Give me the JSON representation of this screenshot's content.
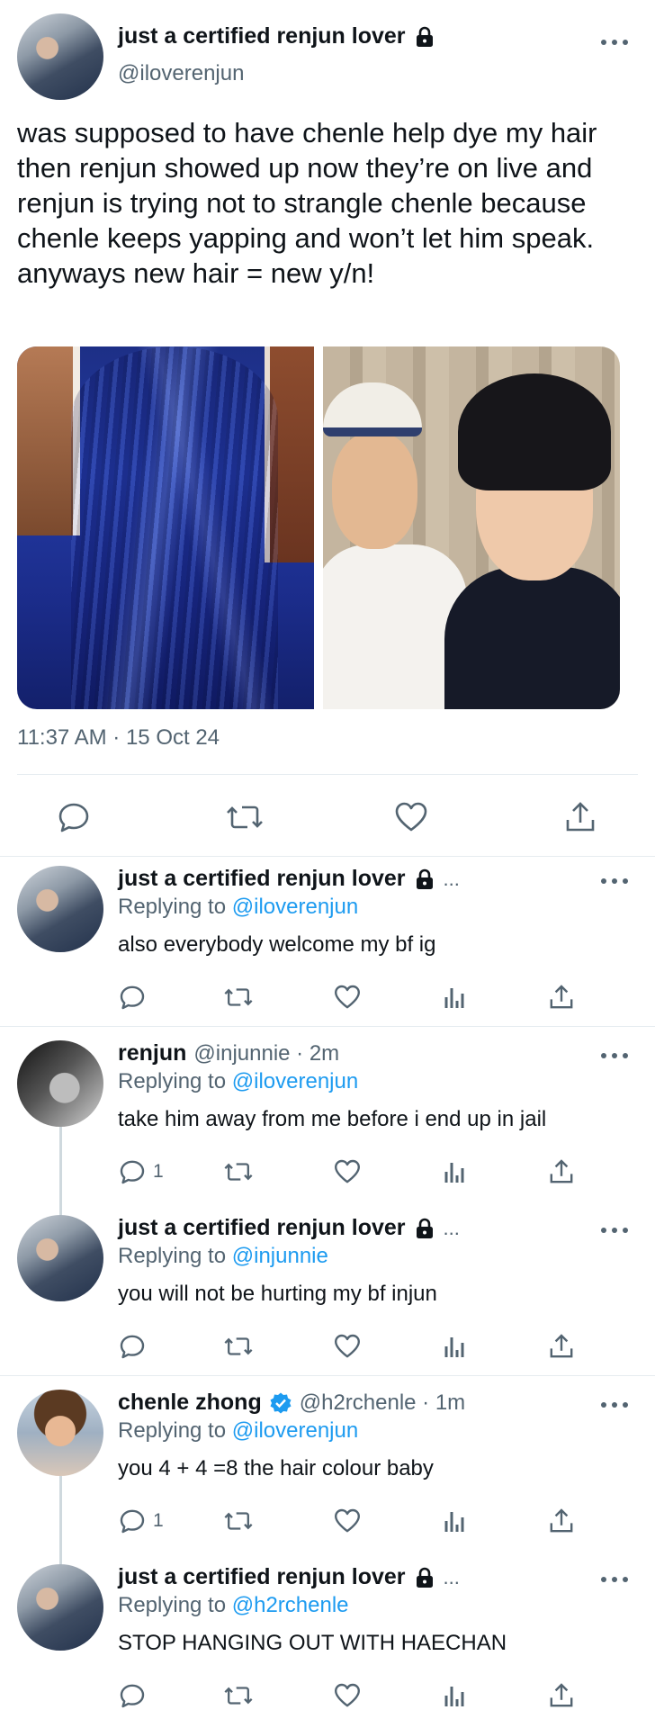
{
  "main_tweet": {
    "display_name": "just a certified renjun lover",
    "handle": "@iloverenjun",
    "text": "was supposed to have chenle help dye my hair then renjun showed up now they’re on live and renjun is trying not to strangle chenle because chenle keeps yapping and won’t let him speak. anyways new hair = new y/n!",
    "timestamp": "11:37 AM · 15 Oct 24",
    "icons": [
      "lock-icon",
      "more-icon",
      "reply-icon",
      "retweet-icon",
      "like-icon",
      "share-icon"
    ]
  },
  "replies": [
    {
      "display_name": "just a certified renjun lover",
      "truncation": "...",
      "replying_prefix": "Replying to ",
      "replying_to": "@iloverenjun",
      "text": "also everybody welcome my bf ig",
      "reply_count": ""
    },
    {
      "display_name": "renjun",
      "handle_time": "@injunnie · 2m",
      "replying_prefix": "Replying to ",
      "replying_to": "@iloverenjun",
      "text": "take him away from me before i end up in jail",
      "reply_count": "1"
    },
    {
      "display_name": "just a certified renjun lover",
      "truncation": "...",
      "replying_prefix": "Replying to ",
      "replying_to": "@injunnie",
      "text": "you will not be hurting my bf injun",
      "reply_count": ""
    },
    {
      "display_name": "chenle zhong",
      "handle_time": "@h2rchenle · 1m",
      "replying_prefix": "Replying to ",
      "replying_to": "@iloverenjun",
      "text": "you 4 + 4 =8 the hair colour baby",
      "reply_count": "1"
    },
    {
      "display_name": "just a certified renjun lover",
      "truncation": "...",
      "replying_prefix": "Replying to ",
      "replying_to": "@h2rchenle",
      "text": "STOP HANGING OUT WITH HAECHAN",
      "reply_count": ""
    }
  ],
  "colors": {
    "text": "#0f1419",
    "secondary": "#536471",
    "link": "#1d9bf0",
    "divider": "#e6ecf0"
  }
}
